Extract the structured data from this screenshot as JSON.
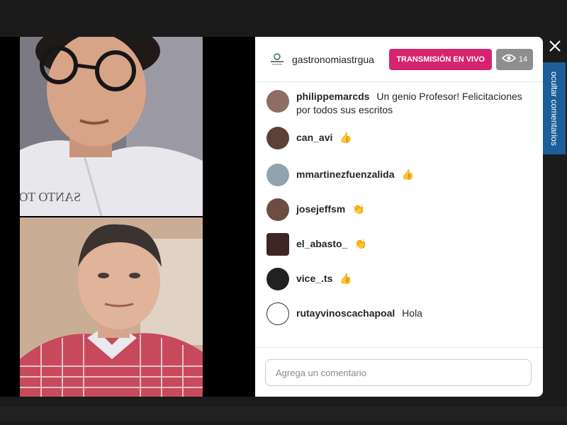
{
  "header": {
    "channel_name": "gastronomiastrgua",
    "live_label": "TRANSMISIÓN EN VIVO",
    "viewer_count": "14"
  },
  "side_tab": {
    "label": "ocultar comentarios"
  },
  "video": {
    "top_feed_text": "SANTO TOMÁS"
  },
  "comments": [
    {
      "username": "philippemarcds",
      "text": "Un genio Profesor! Felicitaciones por todos sus escritos",
      "emoji": "",
      "avatar_color": "#8d6e63"
    },
    {
      "username": "can_avi",
      "text": "",
      "emoji": "👍",
      "avatar_color": "#5d4037"
    },
    {
      "username": "mmartinezfuenzalida",
      "text": "",
      "emoji": "👍",
      "avatar_color": "#90a4ae"
    },
    {
      "username": "josejeffsm",
      "text": "",
      "emoji": "👏",
      "avatar_color": "#6d4c41"
    },
    {
      "username": "el_abasto_",
      "text": "",
      "emoji": "👏",
      "avatar_color": "#3e2723"
    },
    {
      "username": "vice_.ts",
      "text": "",
      "emoji": "👍",
      "avatar_color": "#212121"
    },
    {
      "username": "rutayvinoscachapoal",
      "text": "Hola",
      "emoji": "",
      "avatar_color": "#ffffff"
    }
  ],
  "comment_input": {
    "placeholder": "Agrega un comentario"
  },
  "colors": {
    "live_accent": "#d6246e",
    "side_tab": "#1c5e97",
    "viewer_badge": "#8e8e8e"
  }
}
